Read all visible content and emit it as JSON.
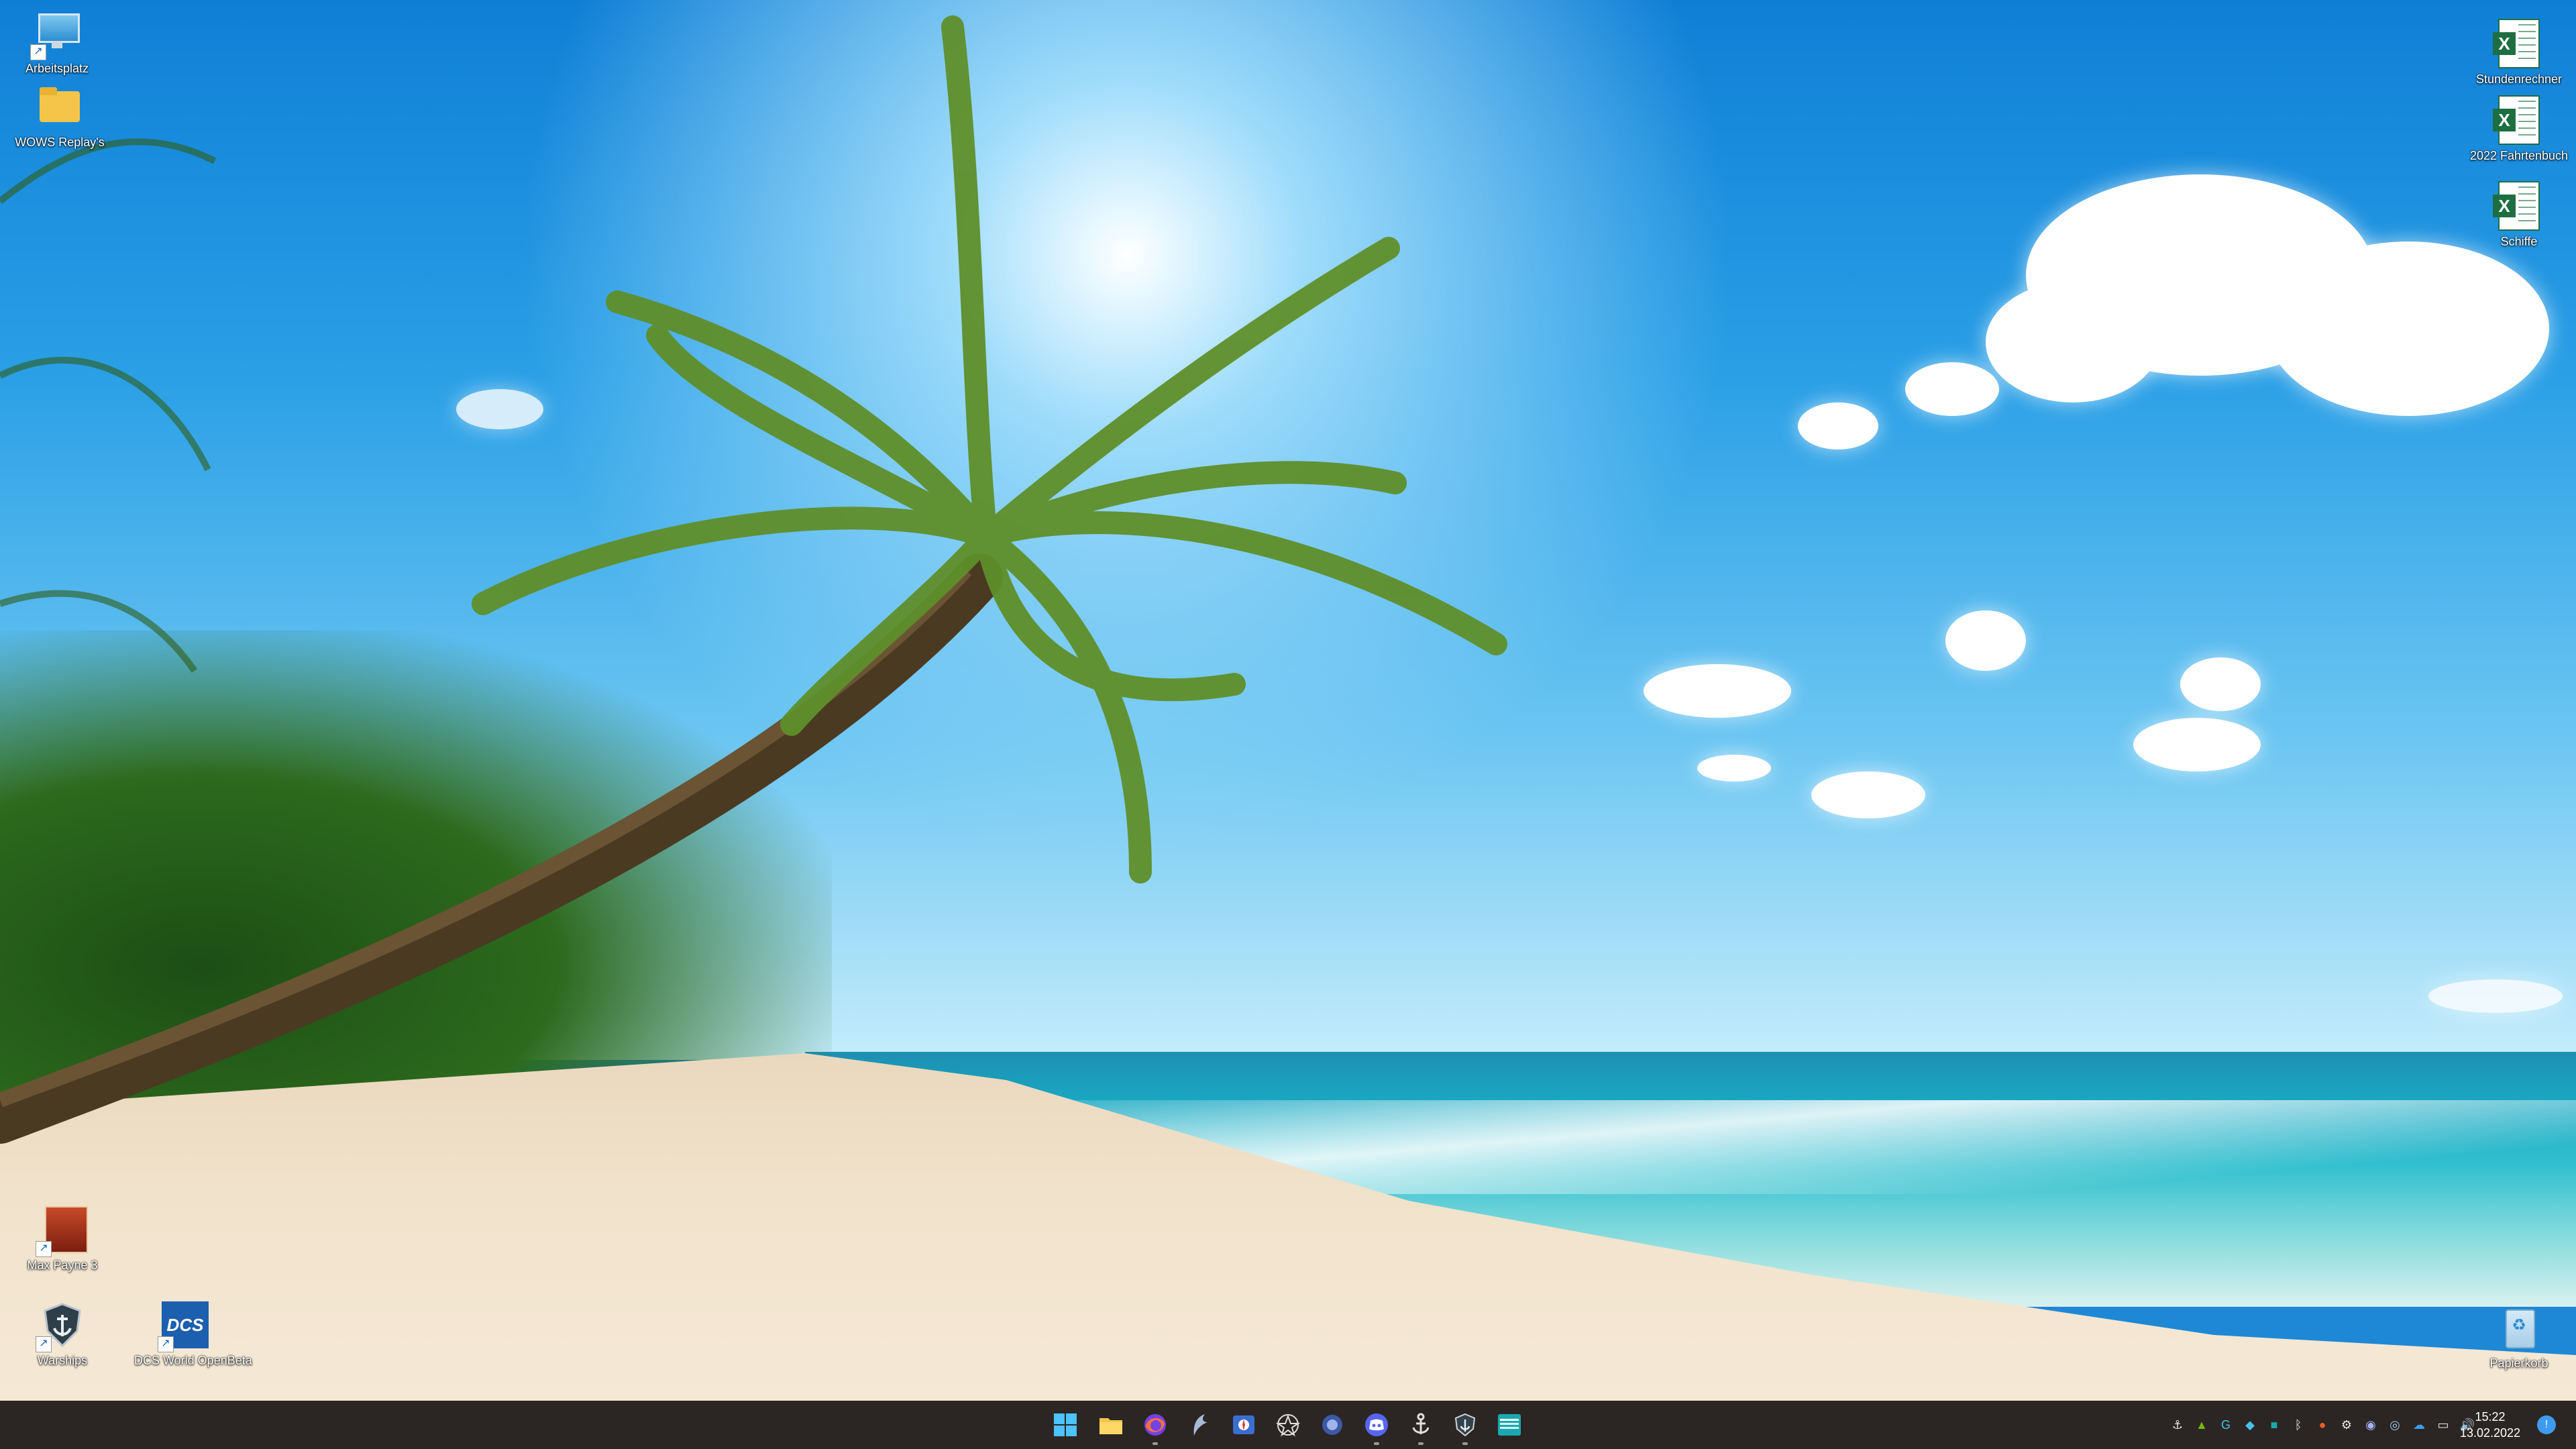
{
  "desktop": {
    "icons_left": [
      {
        "label": "Arbeitsplatz",
        "icon": "computer-icon"
      },
      {
        "label": "WOWS Replay's",
        "icon": "folder-icon"
      },
      {
        "label": "Max Payne 3",
        "icon": "max-payne-game-icon"
      },
      {
        "label": "Warships",
        "icon": "warships-game-icon"
      },
      {
        "label": "DCS World OpenBeta",
        "icon": "dcs-world-icon"
      }
    ],
    "icons_right": [
      {
        "label": "Stundenrechner",
        "icon": "excel-file-icon"
      },
      {
        "label": "2022 Fahrtenbuch",
        "icon": "excel-file-icon"
      },
      {
        "label": "Schiffe",
        "icon": "excel-file-icon"
      },
      {
        "label": "Papierkorb",
        "icon": "recycle-bin-icon"
      }
    ]
  },
  "taskbar": {
    "pinned": [
      {
        "name": "start-button",
        "icon": "windows-logo-icon"
      },
      {
        "name": "file-explorer",
        "icon": "folder-icon"
      },
      {
        "name": "firefox",
        "icon": "firefox-icon"
      },
      {
        "name": "app-bird",
        "icon": "bird-icon"
      },
      {
        "name": "app-map",
        "icon": "map-icon"
      },
      {
        "name": "app-star",
        "icon": "star-icon"
      },
      {
        "name": "app-circle",
        "icon": "circle-app-icon"
      },
      {
        "name": "discord",
        "icon": "discord-icon"
      },
      {
        "name": "warships-launcher",
        "icon": "anchor-icon"
      },
      {
        "name": "warships-client",
        "icon": "ship-icon"
      },
      {
        "name": "app-window",
        "icon": "window-app-icon"
      }
    ],
    "clock": {
      "time": "15:22",
      "date": "13.02.2022"
    }
  },
  "colors": {
    "taskbar_bg": "#2b2623",
    "excel_green": "#1d6f42"
  }
}
